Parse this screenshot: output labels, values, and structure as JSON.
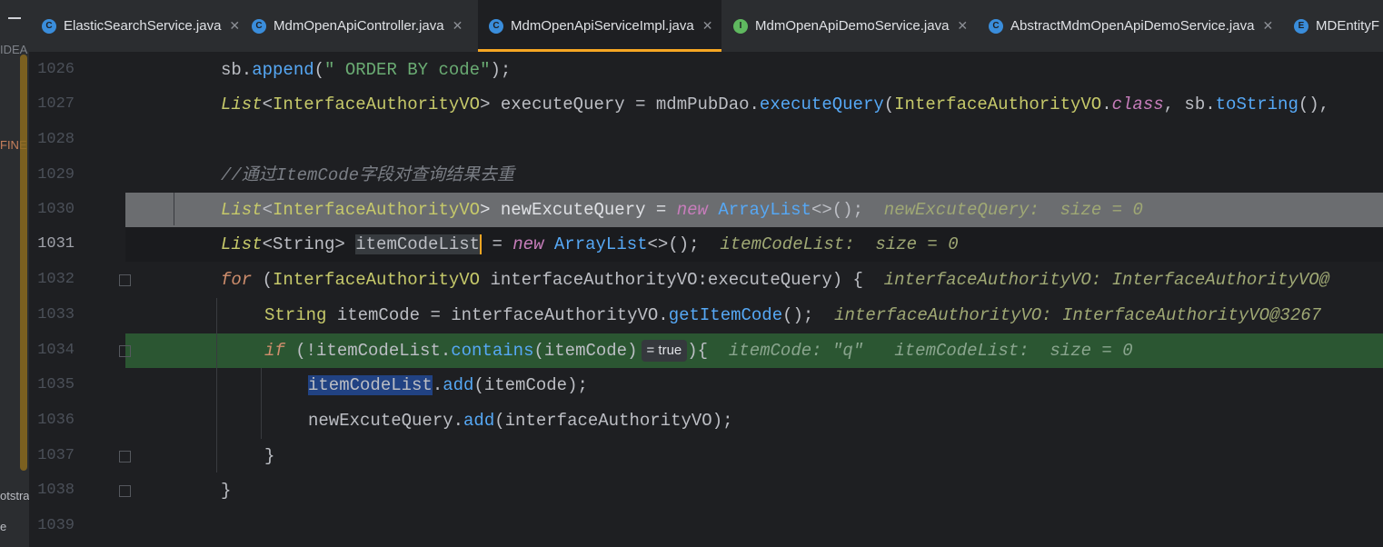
{
  "left_strip": {
    "labels": [
      "IDEA",
      "FINE",
      "otstra",
      "e"
    ]
  },
  "tabs": [
    {
      "label": "ElasticSearchService.java",
      "icon": "class-icon",
      "icon_letter": "C",
      "icon_color": "#3a8ddb",
      "active": false
    },
    {
      "label": "MdmOpenApiController.java",
      "icon": "class-icon",
      "icon_letter": "C",
      "icon_color": "#3a8ddb",
      "active": false
    },
    {
      "label": "MdmOpenApiServiceImpl.java",
      "icon": "class-icon",
      "icon_letter": "C",
      "icon_color": "#3a8ddb",
      "active": true
    },
    {
      "label": "MdmOpenApiDemoService.java",
      "icon": "interface-icon",
      "icon_letter": "I",
      "icon_color": "#5fb85f",
      "active": false
    },
    {
      "label": "AbstractMdmOpenApiDemoService.java",
      "icon": "abstract-class-icon",
      "icon_letter": "C",
      "icon_color": "#3a8ddb",
      "active": false
    },
    {
      "label": "MDEntityF",
      "icon": "enum-icon",
      "icon_letter": "E",
      "icon_color": "#3a8ddb",
      "active": false
    }
  ],
  "line_numbers": [
    "1026",
    "1027",
    "1028",
    "1029",
    "1030",
    "1031",
    "1032",
    "1033",
    "1034",
    "1035",
    "1036",
    "1037",
    "1038",
    "1039"
  ],
  "code": {
    "l1026": {
      "a": "sb.",
      "b": "append",
      "c": "(",
      "d": "\" ORDER BY code\"",
      "e": ");"
    },
    "l1027": {
      "a": "List",
      "b": "<",
      "c": "InterfaceAuthorityVO",
      "d": "> executeQuery = mdmPubDao.",
      "e": "executeQuery",
      "f": "(",
      "g": "InterfaceAuthorityVO",
      "h": ".",
      "i": "class",
      "j": ", sb.",
      "k": "toString",
      "l": "(), "
    },
    "l1029": {
      "comment": "//通过ItemCode字段对查询结果去重"
    },
    "l1030": {
      "a": "List",
      "b": "<",
      "c": "InterfaceAuthorityVO",
      "d": "> newExcuteQuery = ",
      "e": "new",
      "f": " ArrayList",
      "g": "<>",
      "h": "();",
      "inlay": "newExcuteQuery:  size = 0"
    },
    "l1031": {
      "a": "List",
      "b": "<String> ",
      "c": "itemCodeList",
      "d": " = ",
      "e": "new",
      "f": " ArrayList",
      "g": "<>",
      "h": "();",
      "inlay": "itemCodeList:  size = 0"
    },
    "l1032": {
      "a": "for",
      "b": " (",
      "c": "InterfaceAuthorityVO",
      "d": " interfaceAuthorityVO:executeQuery) {",
      "inlay": "interfaceAuthorityVO: InterfaceAuthorityVO@"
    },
    "l1033": {
      "a": "String",
      "b": " itemCode = interfaceAuthorityVO.",
      "c": "getItemCode",
      "d": "();",
      "inlay": "interfaceAuthorityVO: InterfaceAuthorityVO@3267"
    },
    "l1034": {
      "a": "if",
      "b": " (!itemCodeList.",
      "c": "contains",
      "d": "(itemCode)",
      "badge": "= true",
      "e": "){",
      "inlay1": "itemCode: \"q\"",
      "inlay2": "itemCodeList:  size = 0"
    },
    "l1035": {
      "a": "itemCodeList",
      "b": ".",
      "c": "add",
      "d": "(itemCode);"
    },
    "l1036": {
      "a": "newExcuteQuery.",
      "b": "add",
      "c": "(interfaceAuthorityVO);"
    },
    "l1037": {
      "a": "}"
    },
    "l1038": {
      "a": "}"
    }
  }
}
